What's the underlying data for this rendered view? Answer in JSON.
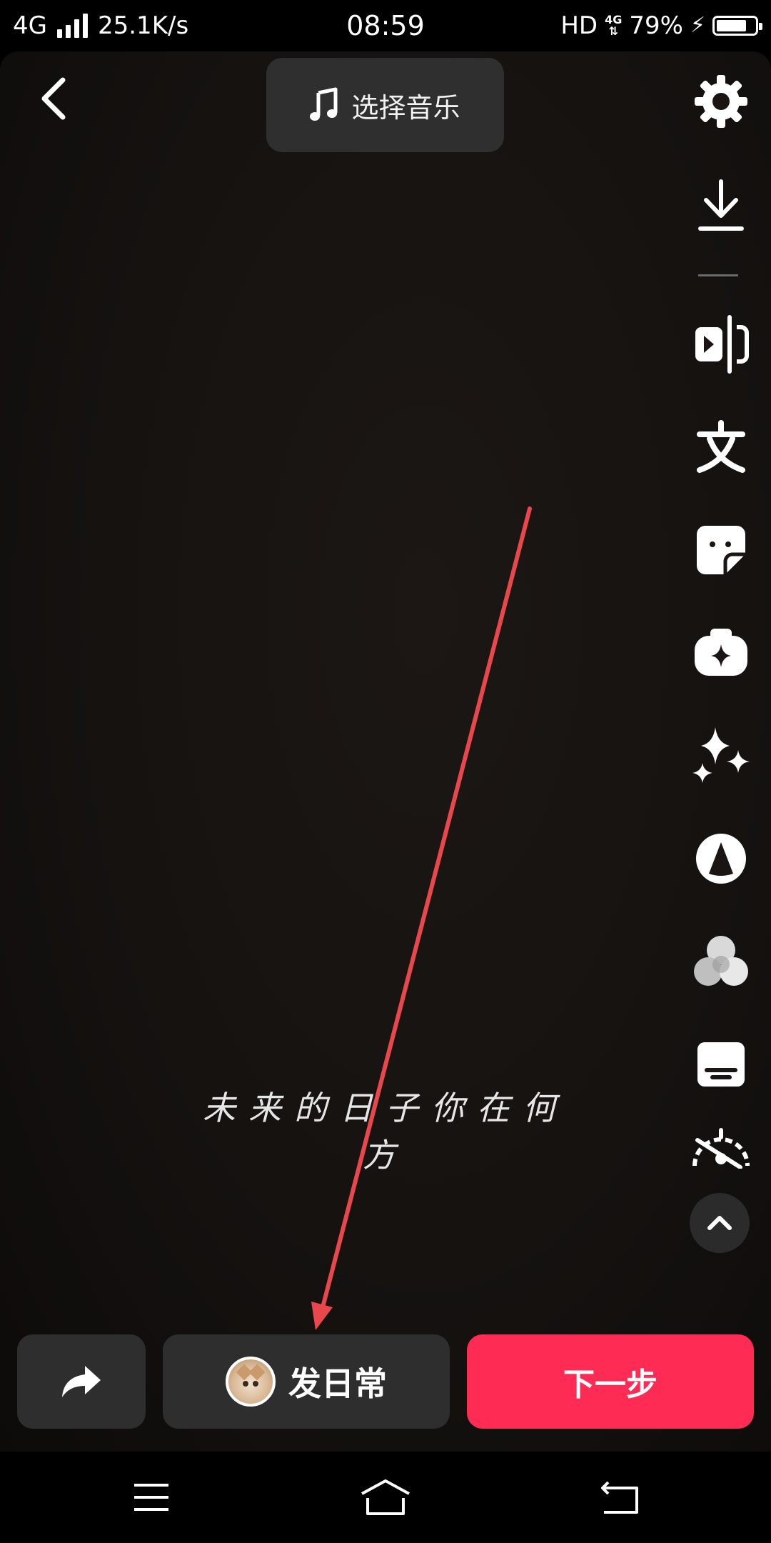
{
  "status_bar": {
    "network": "4G",
    "speed": "25.1K/s",
    "time": "08:59",
    "hd": "HD",
    "net_small": "4G",
    "battery": "79%",
    "battery_level": 0.79
  },
  "top": {
    "back_icon": "chevron-left-icon",
    "music_label": "选择音乐",
    "music_icon": "music-note-icon"
  },
  "side_tools": [
    {
      "name": "settings-button",
      "icon": "gear-icon"
    },
    {
      "name": "download-button",
      "icon": "download-icon"
    },
    {
      "name": "split-button",
      "icon": "play-split-icon"
    },
    {
      "name": "text-button",
      "icon": "text-wen-icon"
    },
    {
      "name": "sticker-button",
      "icon": "sticker-icon"
    },
    {
      "name": "effects-button",
      "icon": "effects-icon"
    },
    {
      "name": "enhance-button",
      "icon": "sparkles-icon"
    },
    {
      "name": "mask-button",
      "icon": "triangle-circle-icon"
    },
    {
      "name": "filter-button",
      "icon": "filter-circles-icon"
    },
    {
      "name": "caption-button",
      "icon": "caption-icon"
    },
    {
      "name": "speed-button",
      "icon": "speed-off-icon"
    }
  ],
  "canvas": {
    "lyric": "未来的日子你在何方"
  },
  "bottom": {
    "share_icon": "share-arrow-icon",
    "daily_label": "发日常",
    "next_label": "下一步"
  },
  "nav": {
    "menu_icon": "menu-icon",
    "home_icon": "home-icon",
    "back_icon": "back-icon"
  },
  "colors": {
    "accent": "#fe2c55",
    "button_bg": "#2e2e2e",
    "annotation_arrow": "#e8474c"
  }
}
